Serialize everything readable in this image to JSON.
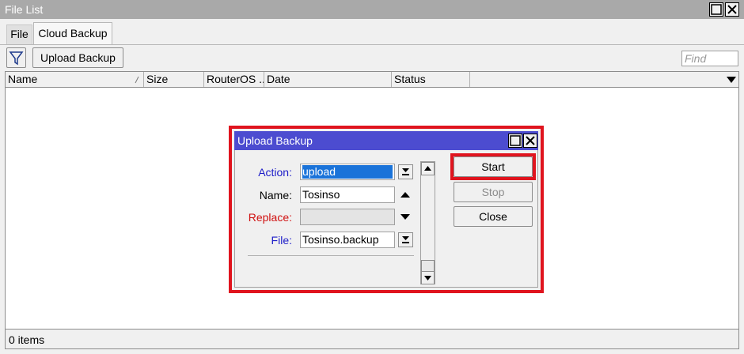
{
  "window": {
    "title": "File List"
  },
  "tabs": [
    {
      "label": "File"
    },
    {
      "label": "Cloud Backup"
    }
  ],
  "toolbar": {
    "filter_icon": "funnel-icon",
    "upload_label": "Upload Backup",
    "find_placeholder": "Find"
  },
  "table": {
    "columns": [
      {
        "label": "Name"
      },
      {
        "label": "Size"
      },
      {
        "label": "RouterOS ..."
      },
      {
        "label": "Date"
      },
      {
        "label": "Status"
      }
    ]
  },
  "status": {
    "items": "0 items"
  },
  "dialog": {
    "title": "Upload Backup",
    "fields": {
      "action": {
        "label": "Action:",
        "value": "upload"
      },
      "name": {
        "label": "Name:",
        "value": "Tosinso"
      },
      "replace": {
        "label": "Replace:",
        "value": ""
      },
      "file": {
        "label": "File:",
        "value": "Tosinso.backup"
      }
    },
    "buttons": {
      "start": "Start",
      "stop": "Stop",
      "close": "Close"
    }
  },
  "colors": {
    "dialog_title_bg": "#4c4cd0",
    "highlight": "#e0141e",
    "label_blue": "#1c1cc8",
    "label_red": "#d01010",
    "selection": "#1a73d9"
  }
}
